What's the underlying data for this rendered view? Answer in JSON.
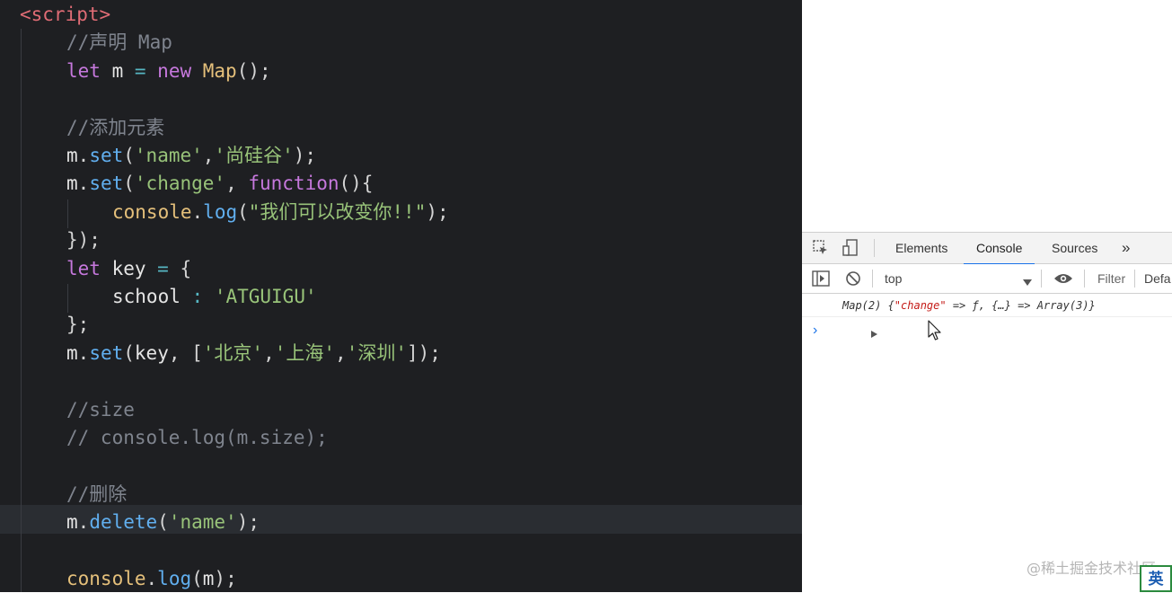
{
  "editor": {
    "lines": [
      {
        "tokens": [
          {
            "t": "<script>",
            "c": "c-tag"
          }
        ]
      },
      {
        "tokens": [
          {
            "t": "//声明 Map",
            "c": "c-comment"
          }
        ]
      },
      {
        "tokens": [
          {
            "t": "let ",
            "c": "c-kw"
          },
          {
            "t": "m ",
            "c": "c-var"
          },
          {
            "t": "= ",
            "c": "c-op"
          },
          {
            "t": "new ",
            "c": "c-kw"
          },
          {
            "t": "Map",
            "c": "c-cls"
          },
          {
            "t": "();",
            "c": "c-punc"
          }
        ]
      },
      {
        "tokens": []
      },
      {
        "tokens": [
          {
            "t": "//添加元素",
            "c": "c-comment"
          }
        ]
      },
      {
        "tokens": [
          {
            "t": "m",
            "c": "c-var"
          },
          {
            "t": ".",
            "c": "c-punc"
          },
          {
            "t": "set",
            "c": "c-fn"
          },
          {
            "t": "(",
            "c": "c-punc"
          },
          {
            "t": "'name'",
            "c": "c-str"
          },
          {
            "t": ",",
            "c": "c-punc"
          },
          {
            "t": "'尚硅谷'",
            "c": "c-str"
          },
          {
            "t": ");",
            "c": "c-punc"
          }
        ]
      },
      {
        "tokens": [
          {
            "t": "m",
            "c": "c-var"
          },
          {
            "t": ".",
            "c": "c-punc"
          },
          {
            "t": "set",
            "c": "c-fn"
          },
          {
            "t": "(",
            "c": "c-punc"
          },
          {
            "t": "'change'",
            "c": "c-str"
          },
          {
            "t": ", ",
            "c": "c-punc"
          },
          {
            "t": "function",
            "c": "c-kw"
          },
          {
            "t": "(){",
            "c": "c-punc"
          }
        ]
      },
      {
        "tokens": [
          {
            "t": "console",
            "c": "c-console"
          },
          {
            "t": ".",
            "c": "c-punc"
          },
          {
            "t": "log",
            "c": "c-fn"
          },
          {
            "t": "(",
            "c": "c-punc"
          },
          {
            "t": "\"我们可以改变你!!\"",
            "c": "c-str"
          },
          {
            "t": ");",
            "c": "c-punc"
          }
        ]
      },
      {
        "tokens": [
          {
            "t": "});",
            "c": "c-punc"
          }
        ]
      },
      {
        "tokens": [
          {
            "t": "let ",
            "c": "c-kw"
          },
          {
            "t": "key ",
            "c": "c-var"
          },
          {
            "t": "= ",
            "c": "c-op"
          },
          {
            "t": "{",
            "c": "c-punc"
          }
        ]
      },
      {
        "tokens": [
          {
            "t": "school ",
            "c": "c-var"
          },
          {
            "t": ": ",
            "c": "c-op"
          },
          {
            "t": "'ATGUIGU'",
            "c": "c-str"
          }
        ]
      },
      {
        "tokens": [
          {
            "t": "};",
            "c": "c-punc"
          }
        ]
      },
      {
        "tokens": [
          {
            "t": "m",
            "c": "c-var"
          },
          {
            "t": ".",
            "c": "c-punc"
          },
          {
            "t": "set",
            "c": "c-fn"
          },
          {
            "t": "(",
            "c": "c-punc"
          },
          {
            "t": "key",
            "c": "c-var"
          },
          {
            "t": ", [",
            "c": "c-punc"
          },
          {
            "t": "'北京'",
            "c": "c-str"
          },
          {
            "t": ",",
            "c": "c-punc"
          },
          {
            "t": "'上海'",
            "c": "c-str"
          },
          {
            "t": ",",
            "c": "c-punc"
          },
          {
            "t": "'深圳'",
            "c": "c-str"
          },
          {
            "t": "]);",
            "c": "c-punc"
          }
        ]
      },
      {
        "tokens": []
      },
      {
        "tokens": [
          {
            "t": "//size",
            "c": "c-comment"
          }
        ]
      },
      {
        "tokens": [
          {
            "t": "// console.log(m.size);",
            "c": "c-comment"
          }
        ]
      },
      {
        "tokens": []
      },
      {
        "tokens": [
          {
            "t": "//删除",
            "c": "c-comment"
          }
        ]
      },
      {
        "tokens": [
          {
            "t": "m",
            "c": "c-var"
          },
          {
            "t": ".",
            "c": "c-punc"
          },
          {
            "t": "delete",
            "c": "c-fn"
          },
          {
            "t": "(",
            "c": "c-punc"
          },
          {
            "t": "'name'",
            "c": "c-str"
          },
          {
            "t": ");",
            "c": "c-punc"
          }
        ]
      },
      {
        "tokens": []
      },
      {
        "tokens": [
          {
            "t": "console",
            "c": "c-console"
          },
          {
            "t": ".",
            "c": "c-punc"
          },
          {
            "t": "log",
            "c": "c-fn"
          },
          {
            "t": "(",
            "c": "c-punc"
          },
          {
            "t": "m",
            "c": "c-var"
          },
          {
            "t": ");",
            "c": "c-punc"
          }
        ]
      }
    ]
  },
  "devtools": {
    "tabs": [
      "Elements",
      "Console",
      "Sources",
      "»"
    ],
    "active_tab": "Console",
    "context": "top",
    "filter_placeholder": "Filter",
    "levels_label": "Defa",
    "output_prefix": "Map(2) {",
    "output_key": "\"change\"",
    "output_rest": " => ƒ, {…} => Array(3)}",
    "prompt": "›"
  },
  "watermark": "@稀土掘金技术社区",
  "ime_label": "英"
}
